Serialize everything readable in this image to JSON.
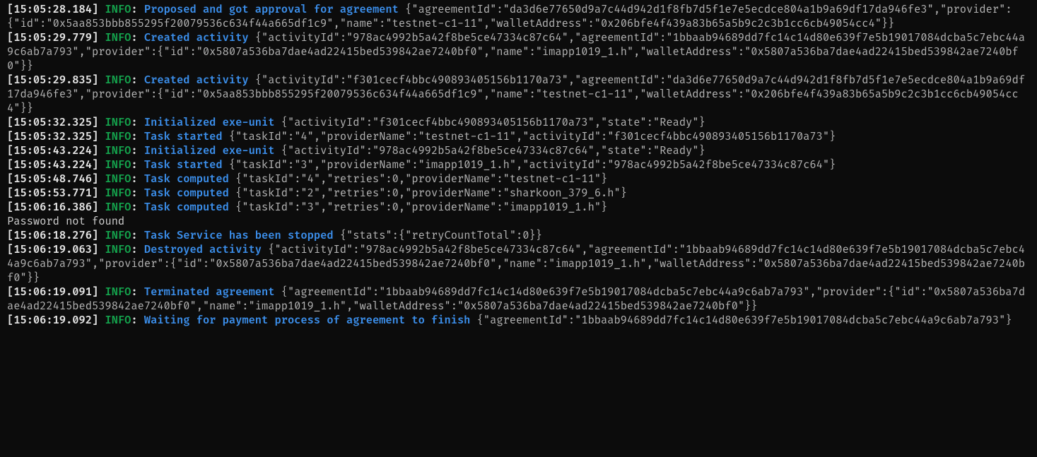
{
  "logs": [
    {
      "type": "log",
      "ts": "[15:05:28.184]",
      "level": "INFO",
      "msg": "Proposed and got approval for agreement",
      "json": "{\"agreementId\":\"da3d6e77650d9a7c44d942d1f8fb7d5f1e7e5ecdce804a1b9a69df17da946fe3\",\"provider\":{\"id\":\"0x5aa853bbb855295f20079536c634f44a665df1c9\",\"name\":\"testnet-c1-11\",\"walletAddress\":\"0x206bfe4f439a83b65a5b9c2c3b1cc6cb49054cc4\"}}"
    },
    {
      "type": "log",
      "ts": "[15:05:29.779]",
      "level": "INFO",
      "msg": "Created activity",
      "json": "{\"activityId\":\"978ac4992b5a42f8be5ce47334c87c64\",\"agreementId\":\"1bbaab94689dd7fc14c14d80e639f7e5b19017084dcba5c7ebc44a9c6ab7a793\",\"provider\":{\"id\":\"0x5807a536ba7dae4ad22415bed539842ae7240bf0\",\"name\":\"imapp1019_1.h\",\"walletAddress\":\"0x5807a536ba7dae4ad22415bed539842ae7240bf0\"}}"
    },
    {
      "type": "log",
      "ts": "[15:05:29.835]",
      "level": "INFO",
      "msg": "Created activity",
      "json": "{\"activityId\":\"f301cecf4bbc490893405156b1170a73\",\"agreementId\":\"da3d6e77650d9a7c44d942d1f8fb7d5f1e7e5ecdce804a1b9a69df17da946fe3\",\"provider\":{\"id\":\"0x5aa853bbb855295f20079536c634f44a665df1c9\",\"name\":\"testnet-c1-11\",\"walletAddress\":\"0x206bfe4f439a83b65a5b9c2c3b1cc6cb49054cc4\"}}"
    },
    {
      "type": "log",
      "ts": "[15:05:32.325]",
      "level": "INFO",
      "msg": "Initialized exe-unit",
      "json": "{\"activityId\":\"f301cecf4bbc490893405156b1170a73\",\"state\":\"Ready\"}"
    },
    {
      "type": "log",
      "ts": "[15:05:32.325]",
      "level": "INFO",
      "msg": "Task started",
      "json": "{\"taskId\":\"4\",\"providerName\":\"testnet-c1-11\",\"activityId\":\"f301cecf4bbc490893405156b1170a73\"}"
    },
    {
      "type": "log",
      "ts": "[15:05:43.224]",
      "level": "INFO",
      "msg": "Initialized exe-unit",
      "json": "{\"activityId\":\"978ac4992b5a42f8be5ce47334c87c64\",\"state\":\"Ready\"}"
    },
    {
      "type": "log",
      "ts": "[15:05:43.224]",
      "level": "INFO",
      "msg": "Task started",
      "json": "{\"taskId\":\"3\",\"providerName\":\"imapp1019_1.h\",\"activityId\":\"978ac4992b5a42f8be5ce47334c87c64\"}"
    },
    {
      "type": "log",
      "ts": "[15:05:48.746]",
      "level": "INFO",
      "msg": "Task computed",
      "json": "{\"taskId\":\"4\",\"retries\":0,\"providerName\":\"testnet-c1-11\"}"
    },
    {
      "type": "log",
      "ts": "[15:05:53.771]",
      "level": "INFO",
      "msg": "Task computed",
      "json": "{\"taskId\":\"2\",\"retries\":0,\"providerName\":\"sharkoon_379_6.h\"}"
    },
    {
      "type": "log",
      "ts": "[15:06:16.386]",
      "level": "INFO",
      "msg": "Task computed",
      "json": "{\"taskId\":\"3\",\"retries\":0,\"providerName\":\"imapp1019_1.h\"}"
    },
    {
      "type": "plain",
      "text": "Password not found"
    },
    {
      "type": "log",
      "ts": "[15:06:18.276]",
      "level": "INFO",
      "msg": "Task Service has been stopped",
      "json": "{\"stats\":{\"retryCountTotal\":0}}"
    },
    {
      "type": "log",
      "ts": "[15:06:19.063]",
      "level": "INFO",
      "msg": "Destroyed activity",
      "json": "{\"activityId\":\"978ac4992b5a42f8be5ce47334c87c64\",\"agreementId\":\"1bbaab94689dd7fc14c14d80e639f7e5b19017084dcba5c7ebc44a9c6ab7a793\",\"provider\":{\"id\":\"0x5807a536ba7dae4ad22415bed539842ae7240bf0\",\"name\":\"imapp1019_1.h\",\"walletAddress\":\"0x5807a536ba7dae4ad22415bed539842ae7240bf0\"}}"
    },
    {
      "type": "log",
      "ts": "[15:06:19.091]",
      "level": "INFO",
      "msg": "Terminated agreement",
      "json": "{\"agreementId\":\"1bbaab94689dd7fc14c14d80e639f7e5b19017084dcba5c7ebc44a9c6ab7a793\",\"provider\":{\"id\":\"0x5807a536ba7dae4ad22415bed539842ae7240bf0\",\"name\":\"imapp1019_1.h\",\"walletAddress\":\"0x5807a536ba7dae4ad22415bed539842ae7240bf0\"}}"
    },
    {
      "type": "log",
      "ts": "[15:06:19.092]",
      "level": "INFO",
      "msg": "Waiting for payment process of agreement to finish",
      "json": "{\"agreementId\":\"1bbaab94689dd7fc14c14d80e639f7e5b19017084dcba5c7ebc44a9c6ab7a793\"}"
    }
  ]
}
